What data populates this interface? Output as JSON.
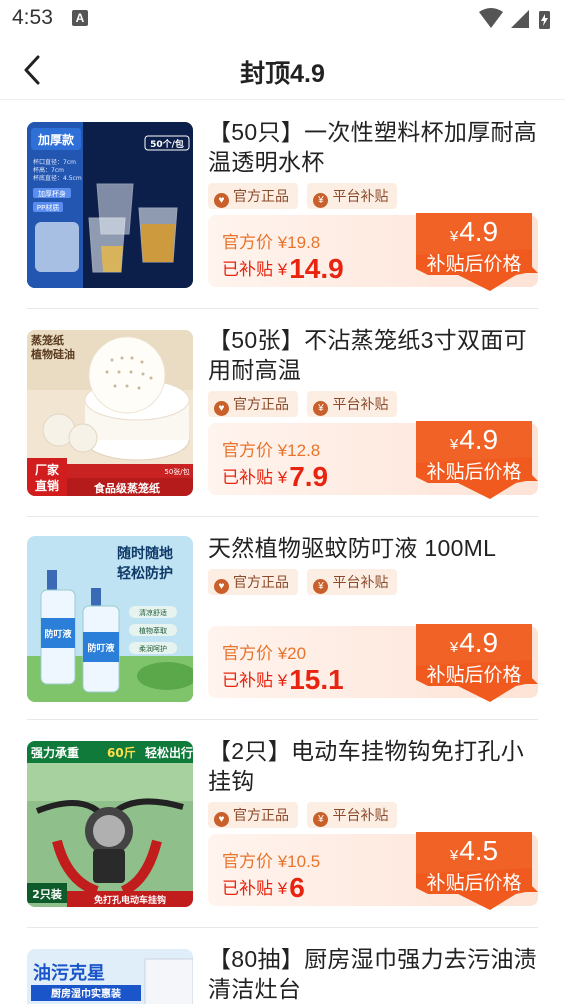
{
  "status": {
    "time": "4:53",
    "notify": "A"
  },
  "nav": {
    "title": "封顶4.9"
  },
  "items": [
    {
      "title": "【50只】一次性塑料杯加厚耐高温透明水杯",
      "tags": [
        "官方正品",
        "平台补贴"
      ],
      "orig_price": "官方价 ¥19.8",
      "sub_label": "已补贴 ¥",
      "sub_price": "14.9",
      "final_yen": "¥",
      "final_price": "4.9",
      "final_label": "补贴后价格",
      "thumb": {
        "t1": "加厚款",
        "t2": "50个/包",
        "t3": "杯口直径：7cm",
        "t4": "杯高：7cm",
        "t5": "杯底直径：4.5cm",
        "t6": "加厚杯身",
        "t7": "PP材质"
      }
    },
    {
      "title": "【50张】不沾蒸笼纸3寸双面可用耐高温",
      "tags": [
        "官方正品",
        "平台补贴"
      ],
      "orig_price": "官方价 ¥12.8",
      "sub_label": "已补贴 ¥",
      "sub_price": "7.9",
      "final_yen": "¥",
      "final_price": "4.9",
      "final_label": "补贴后价格",
      "thumb": {
        "t1": "蒸笼纸",
        "t2": "植物硅油",
        "t3": "厂家",
        "t4": "直销",
        "t5": "食品级蒸笼纸",
        "t6": "50张/包"
      }
    },
    {
      "title": "天然植物驱蚊防叮液 100ML",
      "tags": [
        "官方正品",
        "平台补贴"
      ],
      "orig_price": "官方价 ¥20",
      "sub_label": "已补贴 ¥",
      "sub_price": "15.1",
      "final_yen": "¥",
      "final_price": "4.9",
      "final_label": "补贴后价格",
      "thumb": {
        "t1": "随时随地",
        "t2": "轻松防护",
        "t3": "防叮液",
        "t4": "清凉舒适",
        "t5": "植物萃取",
        "t6": "柔润呵护"
      }
    },
    {
      "title": "【2只】电动车挂物钩免打孔小挂钩",
      "tags": [
        "官方正品",
        "平台补贴"
      ],
      "orig_price": "官方价 ¥10.5",
      "sub_label": "已补贴 ¥",
      "sub_price": "6",
      "final_yen": "¥",
      "final_price": "4.5",
      "final_label": "补贴后价格",
      "thumb": {
        "t1": "强力承重",
        "t2": "60斤",
        "t3": "轻松出行",
        "t4": "2只装",
        "t5": "免打孔电动车挂钩"
      }
    },
    {
      "title": "【80抽】厨房湿巾强力去污油渍清洁灶台",
      "tags": [],
      "thumb": {
        "t1": "油污克星",
        "t2": "厨房湿巾实惠装"
      }
    }
  ],
  "colors": {
    "accent": "#e8230f",
    "badge": "#f05a1e",
    "tag_bg": "#fdeee4"
  }
}
